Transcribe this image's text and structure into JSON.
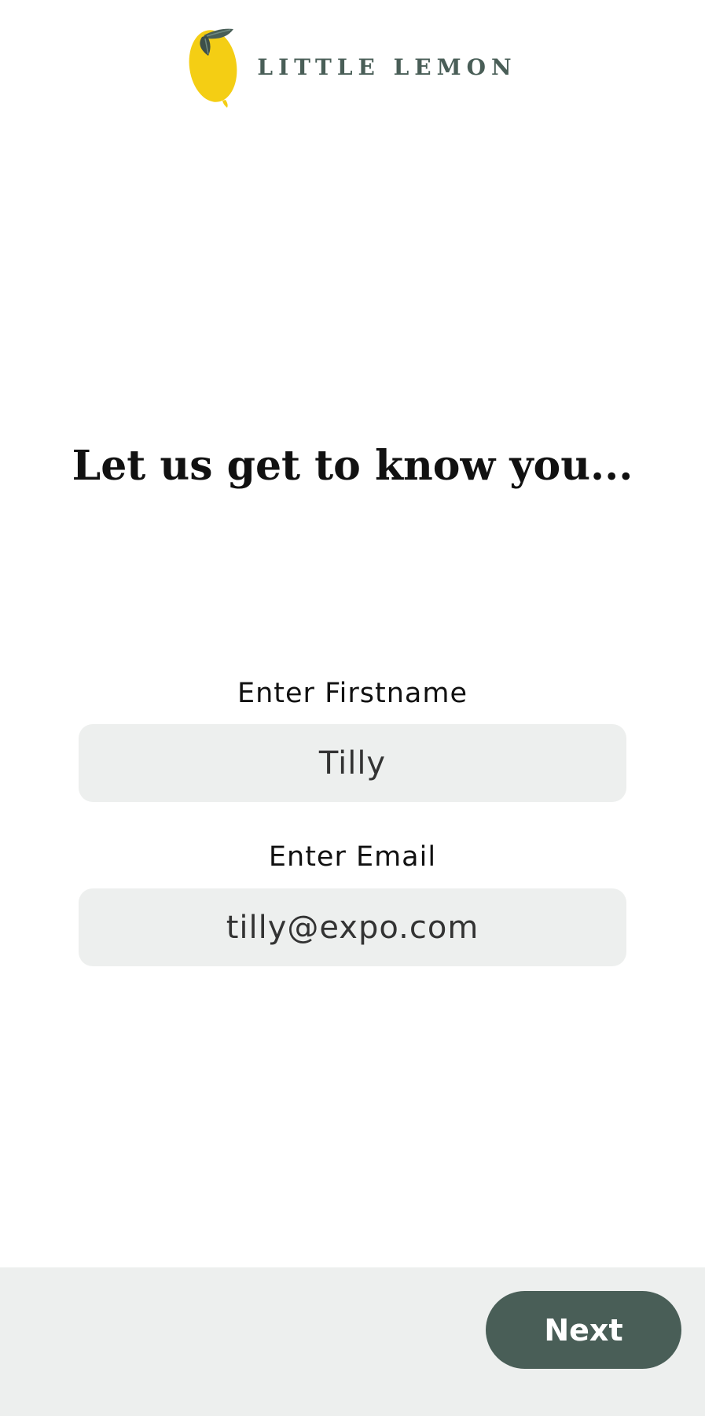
{
  "header": {
    "logo_icon": "lemon-icon",
    "brand_name": "LITTLE LEMON"
  },
  "main": {
    "title": "Let us get to know you...",
    "fields": {
      "firstname": {
        "label": "Enter Firstname",
        "value": "Tilly"
      },
      "email": {
        "label": "Enter Email",
        "value": "tilly@expo.com"
      }
    }
  },
  "footer": {
    "next_label": "Next"
  },
  "colors": {
    "brand_green": "#495e57",
    "lemon_yellow": "#f4ce14",
    "input_background": "#edefee",
    "footer_background": "#edefee"
  }
}
